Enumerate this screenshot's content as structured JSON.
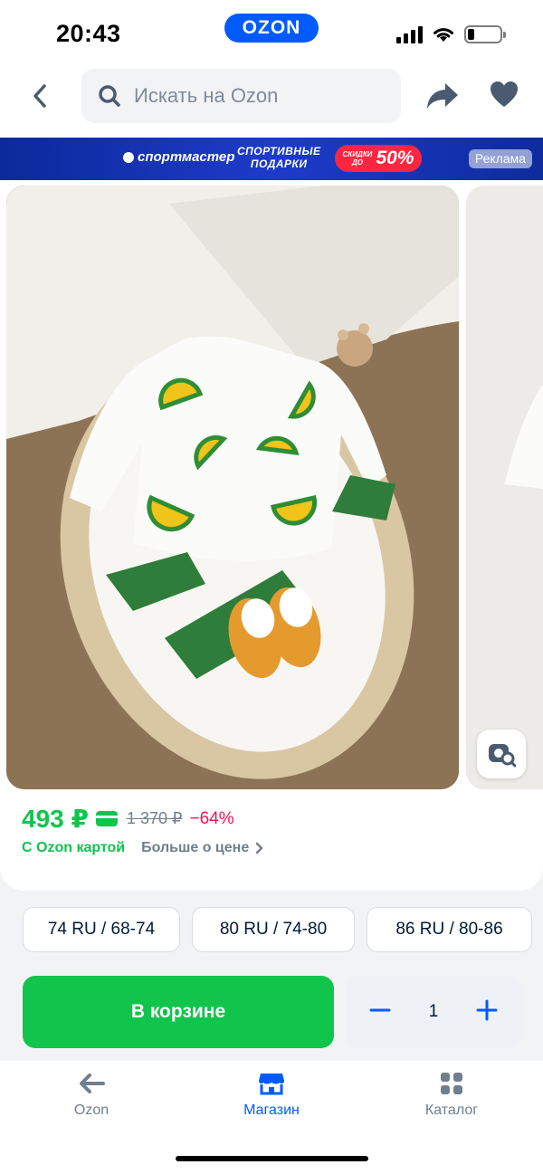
{
  "status_bar": {
    "time": "20:43",
    "brand": "OZON"
  },
  "header": {
    "search_placeholder": "Искать на Ozon",
    "icons": [
      "back-arrow-icon",
      "search-icon",
      "share-icon",
      "heart-icon"
    ]
  },
  "banner": {
    "brand": "спортмастер",
    "text_line1": "СПОРТИВНЫЕ",
    "text_line2": "ПОДАРКИ",
    "sale_small_line1": "СКИДКИ",
    "sale_small_line2": "ДО",
    "sale_big": "50%",
    "ad_label": "Реклама"
  },
  "product": {
    "price": "493 ₽",
    "old_price": "1 370 ₽",
    "discount": "−64%",
    "card_label": "С Ozon картой",
    "more_price": "Больше о цене"
  },
  "sizes": [
    "74 RU / 68-74",
    "80 RU / 74-80",
    "86 RU / 80-86"
  ],
  "cart": {
    "button_label": "В корзине",
    "quantity": "1"
  },
  "tabbar": {
    "items": [
      {
        "label": "Ozon",
        "icon": "arrow-left-icon"
      },
      {
        "label": "Магазин",
        "icon": "store-icon"
      },
      {
        "label": "Каталог",
        "icon": "grid-icon"
      }
    ]
  },
  "colors": {
    "accent": "#005bff",
    "green": "#10c44c",
    "discount": "#f91155"
  }
}
